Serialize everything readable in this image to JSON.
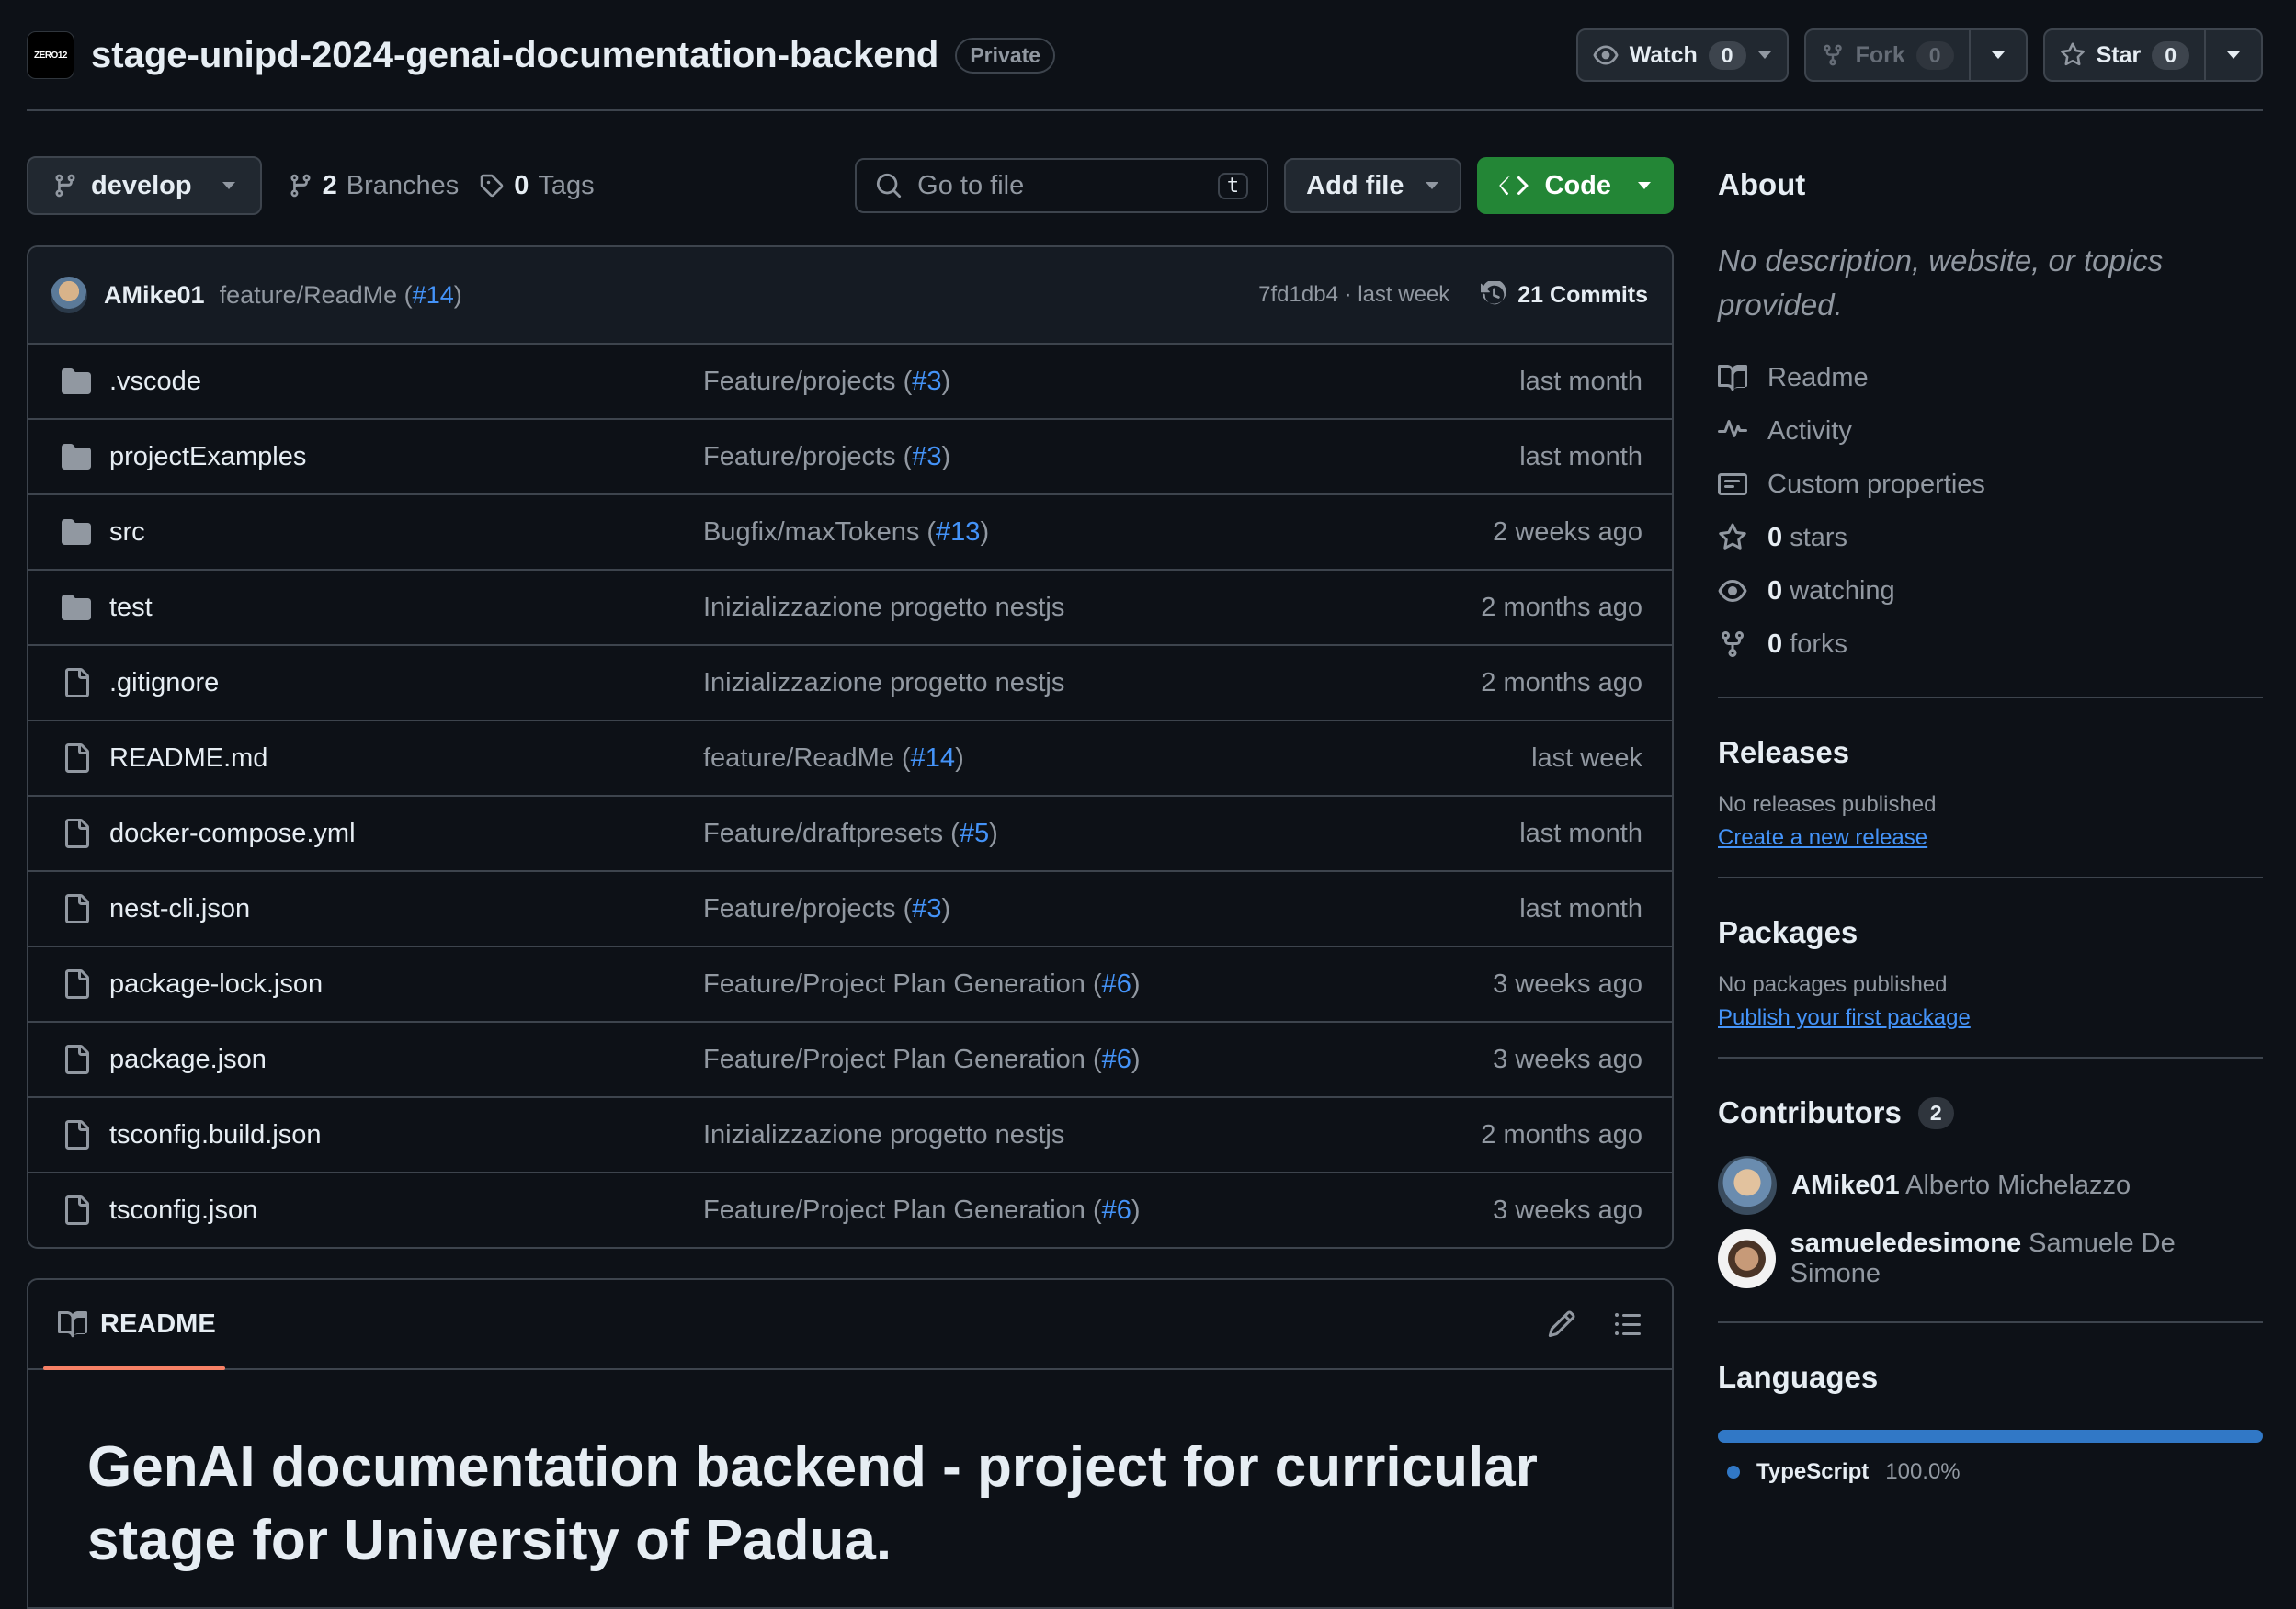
{
  "repo": {
    "owner_logo_text": "ZERO12",
    "name": "stage-unipd-2024-genai-documentation-backend",
    "visibility": "Private"
  },
  "actions": {
    "watch": {
      "label": "Watch",
      "count": "0"
    },
    "fork": {
      "label": "Fork",
      "count": "0"
    },
    "star": {
      "label": "Star",
      "count": "0"
    }
  },
  "toolbar": {
    "branch": "develop",
    "branches_count": "2",
    "branches_label": "Branches",
    "tags_count": "0",
    "tags_label": "Tags",
    "search_placeholder": "Go to file",
    "search_shortcut": "t",
    "add_file_label": "Add file",
    "code_label": "Code"
  },
  "latest_commit": {
    "author": "AMike01",
    "message": "feature/ReadMe (",
    "pr": "#14",
    "message_end": ")",
    "hash_time": "7fd1db4 · last week",
    "commits_label": "21 Commits"
  },
  "files": [
    {
      "type": "dir",
      "name": ".vscode",
      "msg": "Feature/projects (",
      "pr": "#3",
      "msg_end": ")",
      "time": "last month"
    },
    {
      "type": "dir",
      "name": "projectExamples",
      "msg": "Feature/projects (",
      "pr": "#3",
      "msg_end": ")",
      "time": "last month"
    },
    {
      "type": "dir",
      "name": "src",
      "msg": "Bugfix/maxTokens (",
      "pr": "#13",
      "msg_end": ")",
      "time": "2 weeks ago"
    },
    {
      "type": "dir",
      "name": "test",
      "msg": "Inizializzazione progetto nestjs",
      "pr": "",
      "msg_end": "",
      "time": "2 months ago"
    },
    {
      "type": "file",
      "name": ".gitignore",
      "msg": "Inizializzazione progetto nestjs",
      "pr": "",
      "msg_end": "",
      "time": "2 months ago"
    },
    {
      "type": "file",
      "name": "README.md",
      "msg": "feature/ReadMe (",
      "pr": "#14",
      "msg_end": ")",
      "time": "last week"
    },
    {
      "type": "file",
      "name": "docker-compose.yml",
      "msg": "Feature/draftpresets (",
      "pr": "#5",
      "msg_end": ")",
      "time": "last month"
    },
    {
      "type": "file",
      "name": "nest-cli.json",
      "msg": "Feature/projects (",
      "pr": "#3",
      "msg_end": ")",
      "time": "last month"
    },
    {
      "type": "file",
      "name": "package-lock.json",
      "msg": "Feature/Project Plan Generation (",
      "pr": "#6",
      "msg_end": ")",
      "time": "3 weeks ago"
    },
    {
      "type": "file",
      "name": "package.json",
      "msg": "Feature/Project Plan Generation (",
      "pr": "#6",
      "msg_end": ")",
      "time": "3 weeks ago"
    },
    {
      "type": "file",
      "name": "tsconfig.build.json",
      "msg": "Inizializzazione progetto nestjs",
      "pr": "",
      "msg_end": "",
      "time": "2 months ago"
    },
    {
      "type": "file",
      "name": "tsconfig.json",
      "msg": "Feature/Project Plan Generation (",
      "pr": "#6",
      "msg_end": ")",
      "time": "3 weeks ago"
    }
  ],
  "readme": {
    "tab_label": "README",
    "title": "GenAI documentation backend - project for curricular stage for University of Padua."
  },
  "about": {
    "heading": "About",
    "description": "No description, website, or topics provided.",
    "readme_label": "Readme",
    "activity_label": "Activity",
    "custom_props_label": "Custom properties",
    "stars_count": "0",
    "stars_label": "stars",
    "watching_count": "0",
    "watching_label": "watching",
    "forks_count": "0",
    "forks_label": "forks"
  },
  "releases": {
    "heading": "Releases",
    "none": "No releases published",
    "link": "Create a new release"
  },
  "packages": {
    "heading": "Packages",
    "none": "No packages published",
    "link": "Publish your first package"
  },
  "contributors": {
    "heading": "Contributors",
    "count": "2",
    "list": [
      {
        "login": "AMike01",
        "name": "Alberto Michelazzo"
      },
      {
        "login": "samueledesimone",
        "name": "Samuele De Simone"
      }
    ]
  },
  "languages": {
    "heading": "Languages",
    "items": [
      {
        "name": "TypeScript",
        "percent": "100.0%",
        "color": "#3178c6",
        "fraction": 1.0
      }
    ]
  },
  "colors": {
    "background": "#0d1117",
    "border": "#3d444d",
    "link": "#4493f8",
    "code_button": "#238636",
    "tab_underline": "#f78166"
  }
}
